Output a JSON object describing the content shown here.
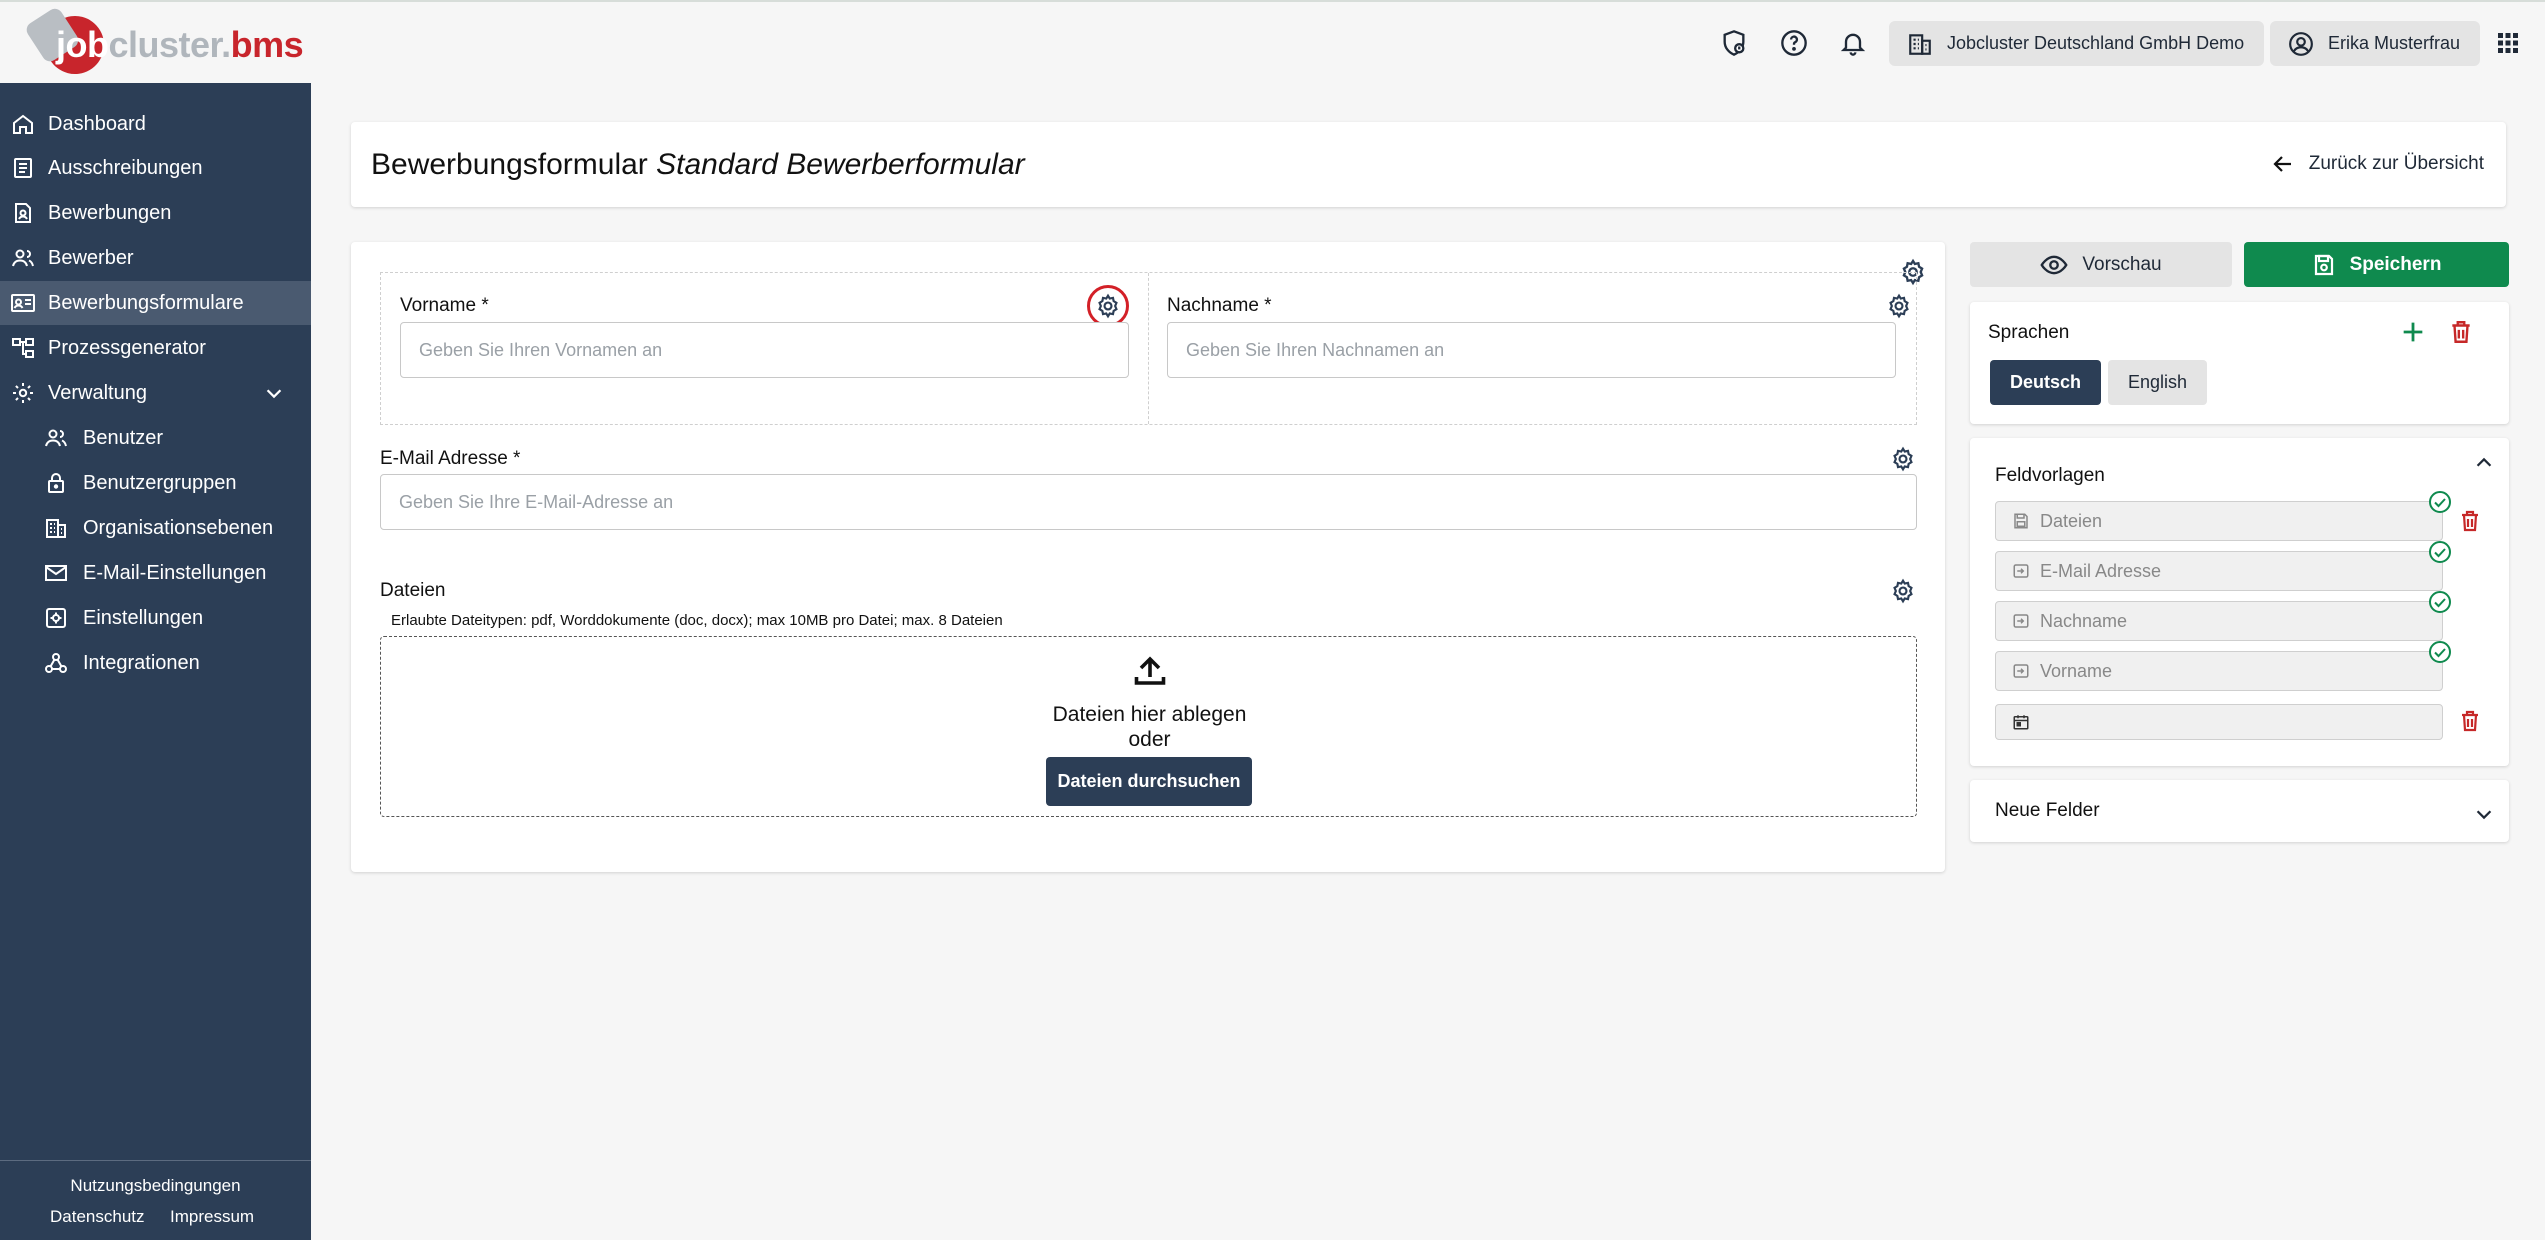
{
  "app": {
    "logo_text_job": "job",
    "logo_text_cluster": "cluster",
    "logo_text_dot": ".",
    "logo_text_bms": "bms"
  },
  "topbar": {
    "org_label": "Jobcluster Deutschland GmbH Demo",
    "user_label": "Erika Musterfrau"
  },
  "sidebar": {
    "items": [
      {
        "label": "Dashboard",
        "icon": "home-icon"
      },
      {
        "label": "Ausschreibungen",
        "icon": "document-list-icon"
      },
      {
        "label": "Bewerbungen",
        "icon": "person-document-icon"
      },
      {
        "label": "Bewerber",
        "icon": "people-icon"
      },
      {
        "label": "Bewerbungsformulare",
        "icon": "id-card-icon"
      },
      {
        "label": "Prozessgenerator",
        "icon": "flow-icon"
      },
      {
        "label": "Verwaltung",
        "icon": "gear-icon"
      }
    ],
    "sub_items": [
      {
        "label": "Benutzer",
        "icon": "people-icon"
      },
      {
        "label": "Benutzergruppen",
        "icon": "lock-icon"
      },
      {
        "label": "Organisationsebenen",
        "icon": "building-icon"
      },
      {
        "label": "E-Mail-Einstellungen",
        "icon": "mail-icon"
      },
      {
        "label": "Einstellungen",
        "icon": "settings-box-icon"
      },
      {
        "label": "Integrationen",
        "icon": "webhook-icon"
      }
    ],
    "footer": {
      "terms": "Nutzungsbedingungen",
      "privacy": "Datenschutz",
      "imprint": "Impressum"
    }
  },
  "header": {
    "title_main": "Bewerbungsformular",
    "title_form_name": "Standard Bewerberformular",
    "back_label": "Zurück zur Übersicht"
  },
  "form": {
    "first_name": {
      "label": "Vorname *",
      "placeholder": "Geben Sie Ihren Vornamen an",
      "value": ""
    },
    "last_name": {
      "label": "Nachname *",
      "placeholder": "Geben Sie Ihren Nachnamen an",
      "value": ""
    },
    "email": {
      "label": "E-Mail Adresse *",
      "placeholder": "Geben Sie Ihre E-Mail-Adresse an",
      "value": ""
    },
    "files": {
      "label": "Dateien",
      "hint": "Erlaubte Dateitypen: pdf, Worddokumente (doc, docx); max 10MB pro Datei; max. 8 Dateien",
      "drop_text": "Dateien hier ablegen",
      "or_text": "oder",
      "browse_label": "Dateien durchsuchen"
    }
  },
  "actions": {
    "preview_label": "Vorschau",
    "save_label": "Speichern"
  },
  "languages": {
    "title": "Sprachen",
    "items": [
      {
        "label": "Deutsch",
        "active": true
      },
      {
        "label": "English",
        "active": false
      }
    ]
  },
  "templates": {
    "title": "Feldvorlagen",
    "items": [
      {
        "label": "Dateien",
        "icon": "save-icon",
        "used": true
      },
      {
        "label": "E-Mail Adresse",
        "icon": "input-icon",
        "used": true
      },
      {
        "label": "Nachname",
        "icon": "input-icon",
        "used": true
      },
      {
        "label": "Vorname",
        "icon": "input-icon",
        "used": true
      },
      {
        "label": "",
        "icon": "calendar-icon",
        "used": false
      }
    ]
  },
  "new_fields": {
    "title": "Neue Felder"
  },
  "colors": {
    "sidebar_bg": "#2c3e56",
    "save_green": "#0f8a4e",
    "danger_red": "#c62828",
    "highlight_red": "#d32027"
  }
}
